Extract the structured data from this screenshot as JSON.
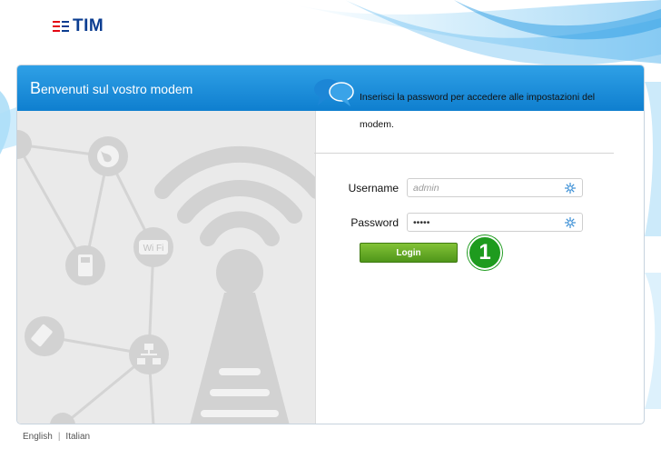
{
  "brand": {
    "name": "TIM"
  },
  "header": {
    "title": "Benvenuti sul vostro modem"
  },
  "info": {
    "text": "Inserisci la password per accedere alle impostazioni del modem."
  },
  "illustration": {
    "wifi_badge": "Wi Fi"
  },
  "form": {
    "username_label": "Username",
    "username_placeholder": "admin",
    "password_label": "Password",
    "password_value": "admin",
    "login_label": "Login"
  },
  "annotation": {
    "step": "1"
  },
  "languages": [
    "English",
    "Italian"
  ],
  "colors": {
    "header_blue": "#1f8fdc",
    "brand_blue": "#0b3d91",
    "brand_red": "#e30613",
    "login_green": "#62a827",
    "badge_green": "#1e9b1e"
  }
}
